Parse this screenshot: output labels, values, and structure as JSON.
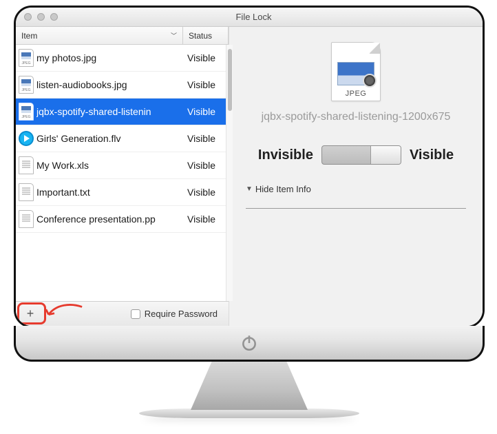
{
  "window": {
    "title": "File Lock"
  },
  "headers": {
    "item": "Item",
    "status": "Status"
  },
  "items": [
    {
      "name": "my photos.jpg",
      "status": "Visible",
      "icon": "jpeg-icon",
      "selected": false
    },
    {
      "name": "listen-audiobooks.jpg",
      "status": "Visible",
      "icon": "jpeg-icon",
      "selected": false
    },
    {
      "name": "jqbx-spotify-shared-listenin",
      "status": "Visible",
      "icon": "jpeg-icon",
      "selected": true
    },
    {
      "name": "Girls' Generation.flv",
      "status": "Visible",
      "icon": "video-icon",
      "selected": false
    },
    {
      "name": "My Work.xls",
      "status": "Visible",
      "icon": "doc-icon",
      "selected": false
    },
    {
      "name": "Important.txt",
      "status": "Visible",
      "icon": "text-icon",
      "selected": false
    },
    {
      "name": "Conference presentation.pp",
      "status": "Visible",
      "icon": "doc-icon",
      "selected": false
    }
  ],
  "footer": {
    "require_password_label": "Require Password"
  },
  "detail": {
    "file_type_label": "JPEG",
    "selected_name": "jqbx-spotify-shared-listening-1200x675",
    "toggle_left": "Invisible",
    "toggle_right": "Visible",
    "toggle_state": "Visible",
    "disclosure_label": "Hide Item Info"
  }
}
